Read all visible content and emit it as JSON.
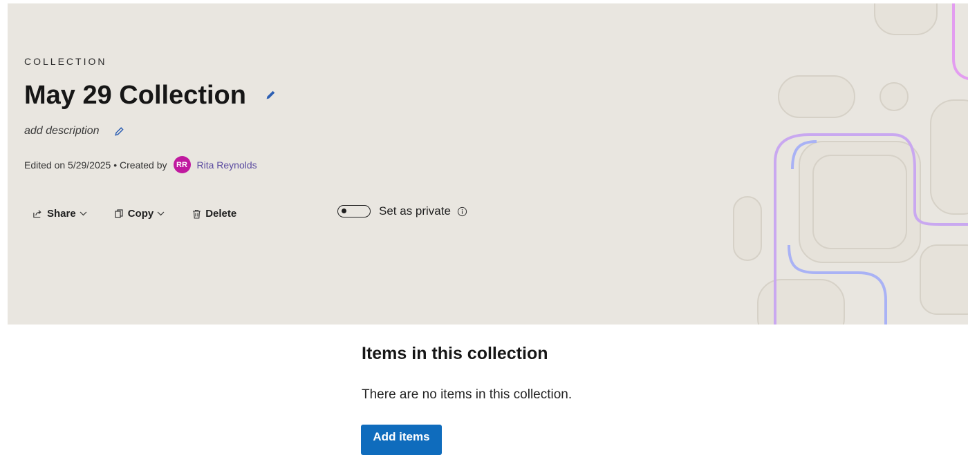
{
  "header": {
    "eyebrow": "COLLECTION",
    "title": "May 29 Collection",
    "description_placeholder": "add description",
    "meta": {
      "edited_text": "Edited on 5/29/2025 • Created by",
      "avatar_initials": "RR",
      "author": "Rita Reynolds"
    },
    "actions": {
      "share": "Share",
      "copy": "Copy",
      "delete": "Delete"
    },
    "private_toggle": {
      "label": "Set as private",
      "checked": false
    }
  },
  "items": {
    "title": "Items in this collection",
    "empty_text": "There are no items in this collection.",
    "add_button": "Add items"
  },
  "colors": {
    "hero_background": "#e9e6e0",
    "avatar": "#c0199f",
    "author_link": "#5a4aa0",
    "primary_button": "#0f6cbd",
    "edit_icon": "#2d5fb3"
  },
  "icons": {
    "edit_title": "pencil-icon",
    "edit_description": "pencil-icon",
    "share": "share-icon",
    "copy": "copy-icon",
    "delete": "trash-icon",
    "info": "info-icon"
  }
}
